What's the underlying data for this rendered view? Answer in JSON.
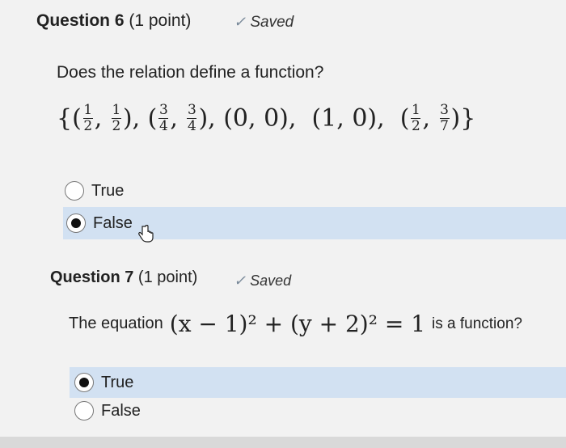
{
  "q6": {
    "title": "Question 6",
    "points": "(1 point)",
    "saved": "Saved",
    "prompt": "Does the relation define a function?",
    "relation": {
      "open": "{(",
      "p1a": {
        "num": "1",
        "den": "2"
      },
      "p1b": {
        "num": "1",
        "den": "2"
      },
      "sep1": "),  (",
      "p2a": {
        "num": "3",
        "den": "4"
      },
      "p2b": {
        "num": "3",
        "den": "4"
      },
      "p3": "), (0, 0),  (1, 0),  (",
      "p5a": {
        "num": "1",
        "den": "2"
      },
      "p5b": {
        "num": "3",
        "den": "7"
      },
      "close": ")}"
    },
    "options": [
      {
        "label": "True",
        "selected": false
      },
      {
        "label": "False",
        "selected": true
      }
    ]
  },
  "q7": {
    "title": "Question 7",
    "points": "(1 point)",
    "saved": "Saved",
    "prompt_pre": "The equation",
    "equation": "(x − 1)² + (y + 2)² = 1",
    "prompt_post": "is a function?",
    "options": [
      {
        "label": "True",
        "selected": true
      },
      {
        "label": "False",
        "selected": false
      }
    ]
  },
  "icons": {
    "check": "checkmark-icon",
    "cursor": "hand-cursor-icon"
  }
}
